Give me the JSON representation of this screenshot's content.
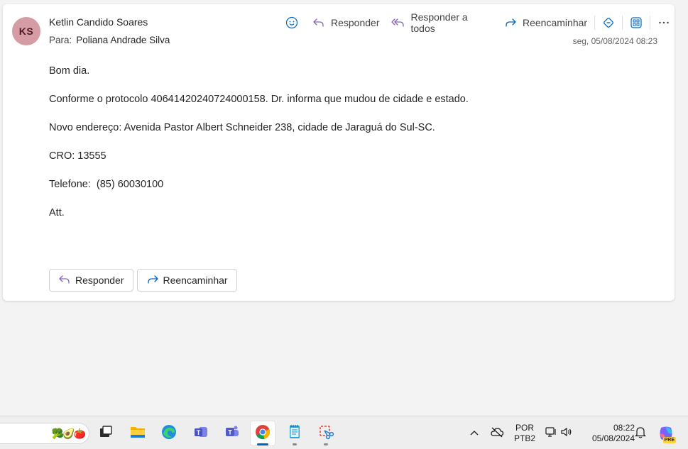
{
  "email": {
    "avatar_initials": "KS",
    "sender": "Ketlin Candido Soares",
    "to_label": "Para:",
    "to_name": "Poliana Andrade Silva",
    "timestamp": "seg, 05/08/2024 08:23",
    "body": [
      "Bom dia.",
      "Conforme o protocolo 40641420240724000158. Dr. informa que mudou de cidade e estado.",
      "Novo endereço: Avenida Pastor Albert Schneider 238, cidade de Jaraguá do Sul-SC.",
      "CRO: 13555",
      "Telefone:  (85) 60030100",
      "Att."
    ]
  },
  "actions": {
    "reply": "Responder",
    "reply_all": "Responder a todos",
    "forward": "Reencaminhar"
  },
  "bottom_buttons": {
    "reply": "Responder",
    "forward": "Reencaminhar"
  },
  "taskbar": {
    "apps": [
      "task-view",
      "file-explorer",
      "edge",
      "teams-classic",
      "teams",
      "chrome",
      "notepad",
      "snipping-tool"
    ],
    "active_app": "chrome",
    "lang_top": "POR",
    "lang_bottom": "PTB2",
    "time": "08:22",
    "date": "05/08/2024",
    "copilot_badge": "PRE"
  },
  "colors": {
    "avatar_bg": "#d69ca5",
    "accent_blue": "#0067c0",
    "reply_purple": "#8764b8"
  }
}
